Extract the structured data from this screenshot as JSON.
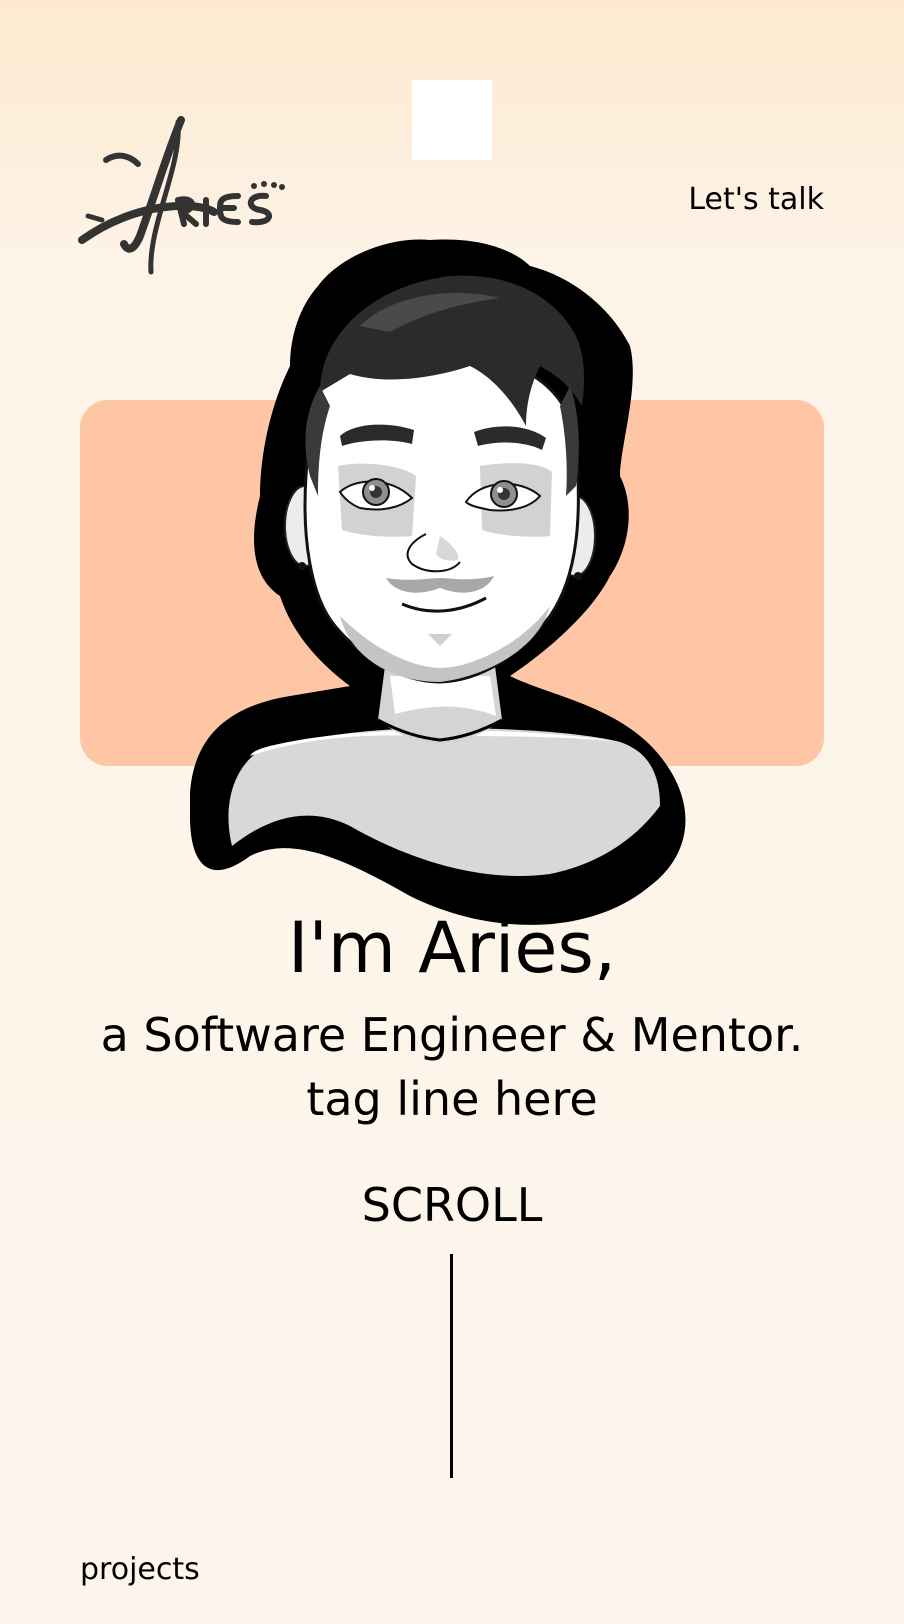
{
  "header": {
    "logo_text": "ARIES",
    "cta_label": "Let's talk"
  },
  "hero": {
    "headline": "I'm Aries,",
    "subtitle": "a Software Engineer & Mentor.",
    "tagline": "tag line here",
    "scroll_label": "SCROLL",
    "card_color": "#fec6a5"
  },
  "footer": {
    "projects_label": "projects"
  },
  "icons": {
    "logo": "aries-logo",
    "avatar": "avatar-illustration",
    "top_square": "blank-square"
  }
}
